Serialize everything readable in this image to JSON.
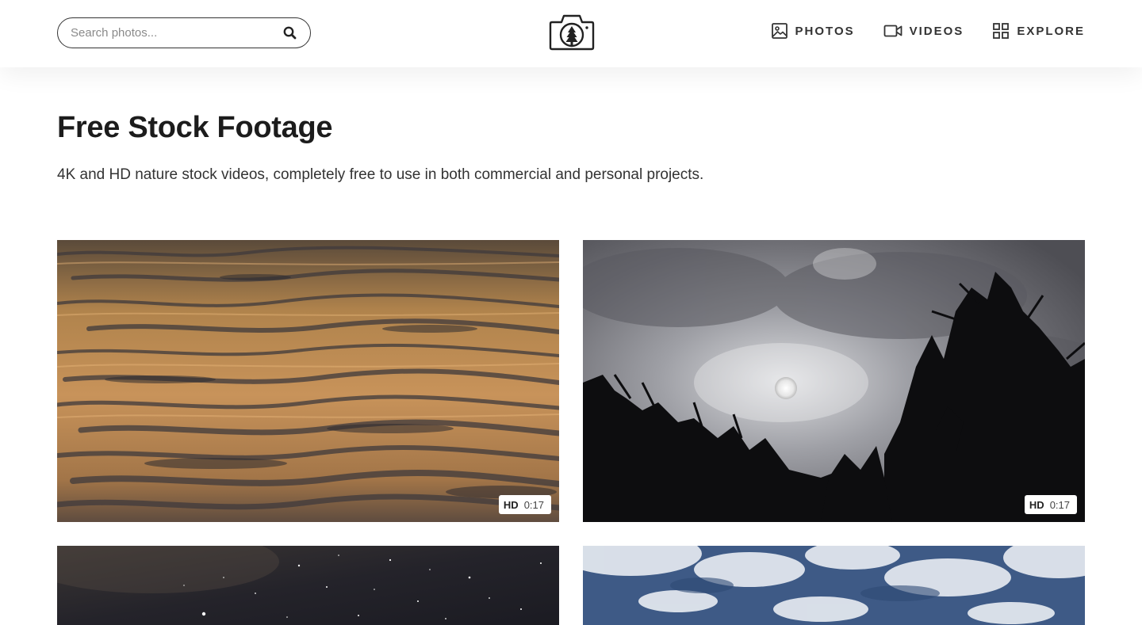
{
  "search": {
    "placeholder": "Search photos..."
  },
  "nav": [
    {
      "label": "PHOTOS",
      "icon": "image-icon"
    },
    {
      "label": "VIDEOS",
      "icon": "video-camera-icon"
    },
    {
      "label": "EXPLORE",
      "icon": "grid-icon"
    }
  ],
  "hero": {
    "title": "Free Stock Footage",
    "subtitle": "4K and HD nature stock videos, completely free to use in both commercial and personal projects."
  },
  "videos": [
    {
      "quality": "HD",
      "duration": "0:17"
    },
    {
      "quality": "HD",
      "duration": "0:17"
    },
    {
      "quality": "",
      "duration": ""
    },
    {
      "quality": "",
      "duration": ""
    }
  ]
}
